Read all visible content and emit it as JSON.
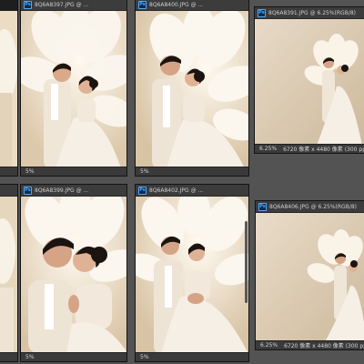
{
  "windows": [
    {
      "id": "w1",
      "title": "",
      "zoom": "",
      "info": ""
    },
    {
      "id": "w2",
      "title": "8Q6A8397.JPG @ ...",
      "zoom": "5%",
      "info": ""
    },
    {
      "id": "w3",
      "title": "8Q6A8400.JPG @ ...",
      "zoom": "5%",
      "info": ""
    },
    {
      "id": "w4",
      "title": "8Q6A8391.JPG @ 6.25%(RGB/8)",
      "zoom": "6.25%",
      "info": "6720 像素 x 4480 像素 (300 ppi)"
    },
    {
      "id": "w5",
      "title": "",
      "zoom": "",
      "info": ""
    },
    {
      "id": "w6",
      "title": "8Q6A8399.JPG @ ...",
      "zoom": "5%",
      "info": ""
    },
    {
      "id": "w7",
      "title": "8Q6A8402.JPG @ ...",
      "zoom": "5%",
      "info": ""
    },
    {
      "id": "w8",
      "title": "8Q6A8406.JPG @ 6.25%(RGB/8)",
      "zoom": "6.25%",
      "info": "6720 像素 x 4480 像素 (300 ppi)"
    }
  ],
  "app_icon": "photoshop-document-icon",
  "colors": {
    "workspace": "#535353",
    "titlebar": "#3c3c3c",
    "statusbar": "#3a3a3a",
    "photo_bg": "#e8d9c2",
    "gown": "#f6efe6",
    "hair": "#1b1410"
  }
}
